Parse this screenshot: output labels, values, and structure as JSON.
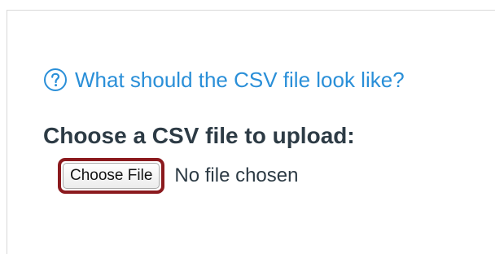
{
  "help": {
    "link_text": "What should the CSV file look like?",
    "icon": "question-circle-icon"
  },
  "upload": {
    "label": "Choose a CSV file to upload:",
    "button_label": "Choose File",
    "status_text": "No file chosen"
  },
  "colors": {
    "link": "#2a8fd8",
    "text": "#2d3b45",
    "highlight": "#8b1a1e"
  }
}
